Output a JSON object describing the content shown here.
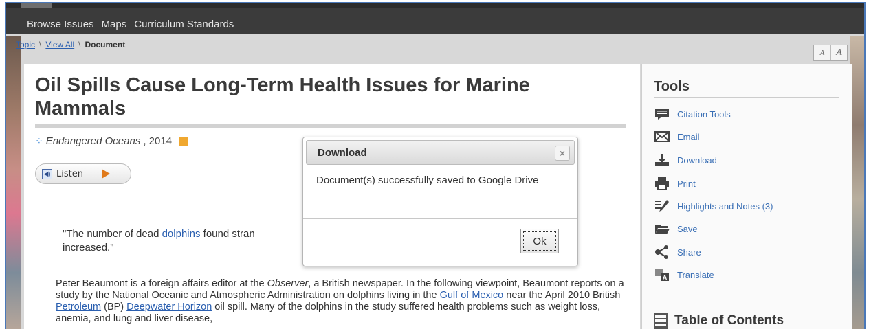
{
  "nav": {
    "items": [
      "Browse Issues",
      "Maps",
      "Curriculum Standards"
    ]
  },
  "breadcrumb": {
    "topic": "Topic",
    "view_all": "View All",
    "current": "Document",
    "sep": "\\"
  },
  "text_size": {
    "small": "A",
    "large": "A"
  },
  "document": {
    "title": "Oil Spills Cause Long-Term Health Issues for Marine Mammals",
    "source_title": "Endangered Oceans",
    "source_year": ", 2014",
    "listen_label": "Listen",
    "quote_before": "\"The number of dead ",
    "quote_link": "dolphins",
    "quote_after": " found stran",
    "quote_line2": "increased.\"",
    "summary": {
      "p1": "Peter Beaumont is a foreign affairs editor at the ",
      "p1_em": "Observer",
      "p2": ", a British newspaper. In the following viewpoint, Beaumont reports on a study by the National Oceanic and Atmospheric Administration on dolphins living in the ",
      "link_gulf": "Gulf of Mexico",
      "p3": " near the April 2010 British ",
      "link_petroleum": "Petroleum",
      "p4": " (BP) ",
      "link_deepwater": "Deepwater Horizon",
      "p5": " oil spill. Many of the dolphins in the study suffered health problems such as weight loss, anemia, and lung and liver disease,"
    }
  },
  "tools": {
    "title": "Tools",
    "items": [
      {
        "label": "Citation Tools",
        "icon": "speech-bubble-icon"
      },
      {
        "label": "Email",
        "icon": "envelope-icon"
      },
      {
        "label": "Download",
        "icon": "download-icon"
      },
      {
        "label": "Print",
        "icon": "printer-icon"
      },
      {
        "label": "Highlights and Notes (3)",
        "icon": "highlighter-icon"
      },
      {
        "label": "Save",
        "icon": "folder-icon"
      },
      {
        "label": "Share",
        "icon": "share-icon"
      },
      {
        "label": "Translate",
        "icon": "translate-icon"
      }
    ],
    "toc_label": "Table of Contents"
  },
  "dialog": {
    "title": "Download",
    "close": "×",
    "message": "Document(s) successfully saved to Google Drive",
    "ok_label": "Ok"
  }
}
